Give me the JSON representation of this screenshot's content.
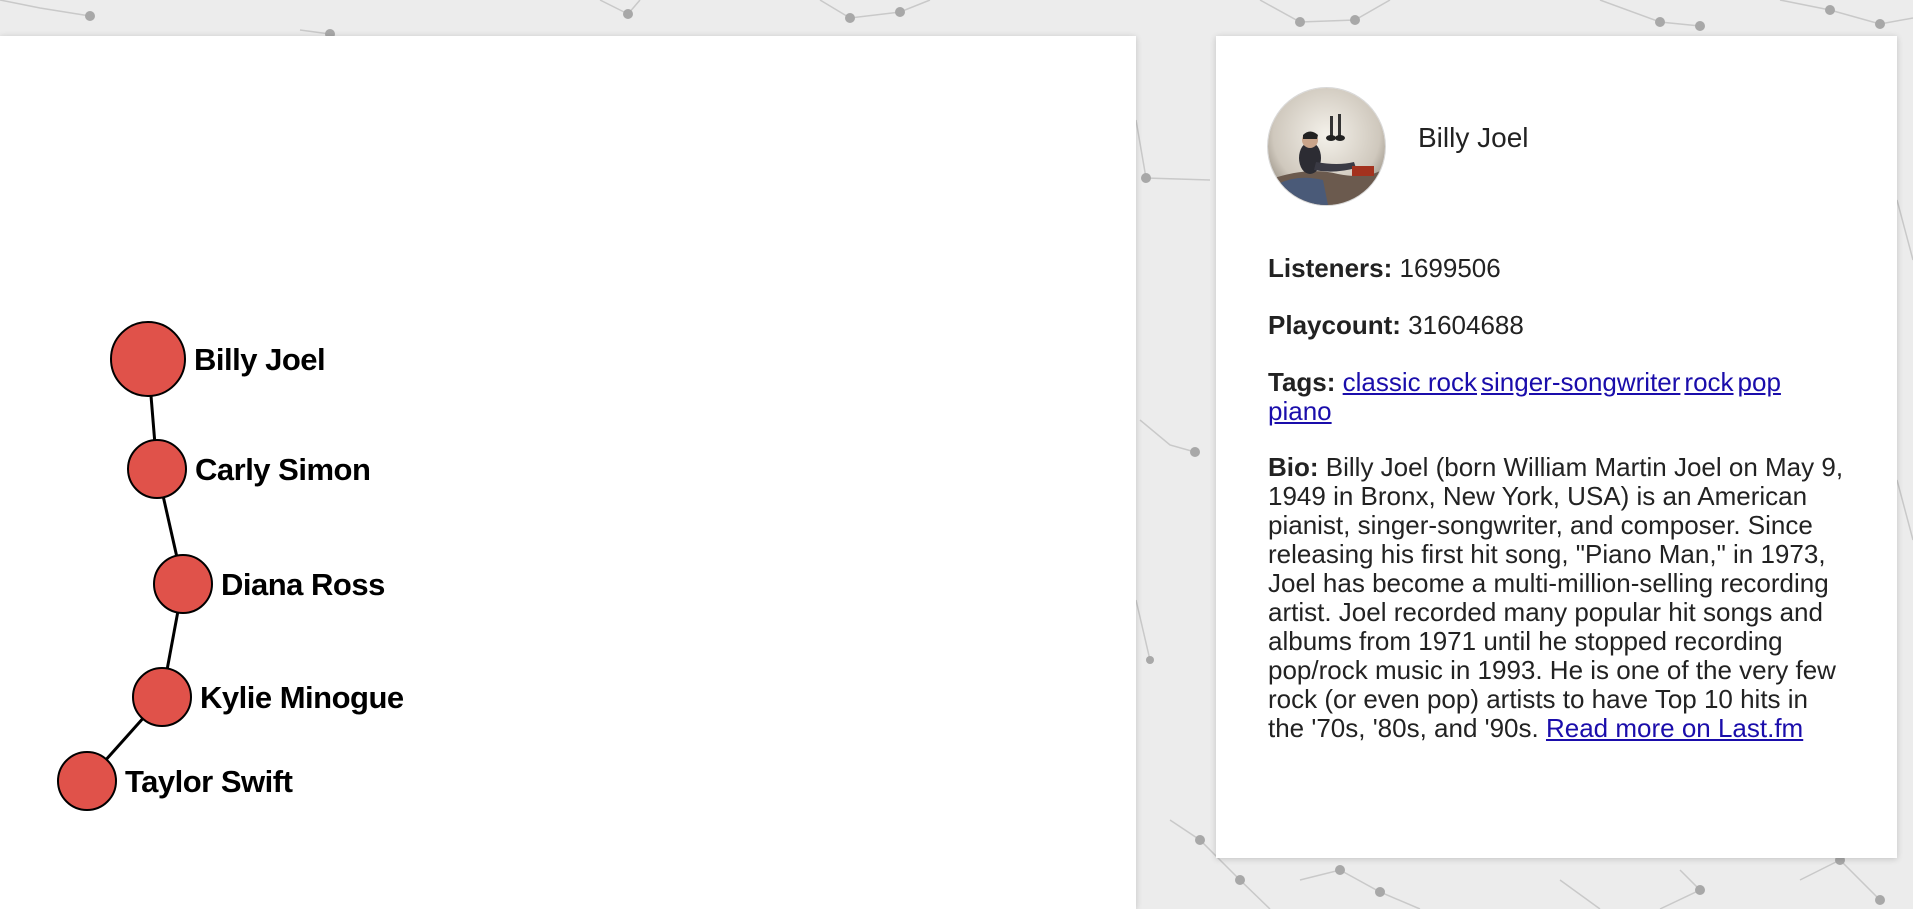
{
  "colors": {
    "node_fill": "#e0524a",
    "node_stroke": "#000000",
    "edge": "#000000",
    "link": "#1a0dab"
  },
  "graph": {
    "nodes": [
      {
        "label": "Billy Joel"
      },
      {
        "label": "Carly Simon"
      },
      {
        "label": "Diana Ross"
      },
      {
        "label": "Kylie Minogue"
      },
      {
        "label": "Taylor Swift"
      }
    ]
  },
  "info": {
    "avatar_icon": "artist-photo",
    "name": "Billy Joel",
    "listeners_label": "Listeners:",
    "listeners_value": "1699506",
    "playcount_label": "Playcount:",
    "playcount_value": "31604688",
    "tags_label": "Tags:",
    "tags": [
      "classic rock",
      "singer-songwriter",
      "rock",
      "pop",
      "piano"
    ],
    "bio_label": "Bio:",
    "bio_text": "Billy Joel (born William Martin Joel on May 9, 1949 in Bronx, New York, USA) is an American pianist, singer-songwriter, and composer. Since releasing his first hit song, \"Piano Man,\" in 1973, Joel has become a multi-million-selling recording artist. Joel recorded many popular hit songs and albums from 1971 until he stopped recording pop/rock music in 1993. He is one of the very few rock (or even pop) artists to have Top 10 hits in the '70s, '80s, and '90s.",
    "read_more": "Read more on Last.fm"
  }
}
